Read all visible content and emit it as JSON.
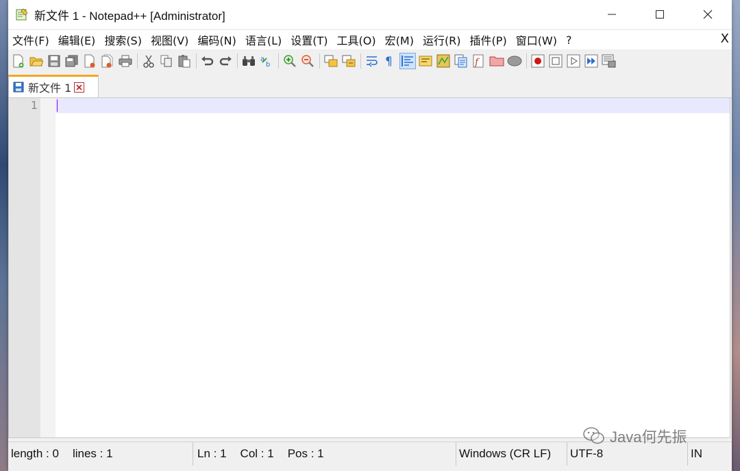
{
  "window": {
    "title": "新文件 1 - Notepad++ [Administrator]",
    "controls": {
      "minimize": "—",
      "maximize": "☐",
      "close": "✕"
    }
  },
  "menubar": {
    "items": [
      "文件(F)",
      "编辑(E)",
      "搜索(S)",
      "视图(V)",
      "编码(N)",
      "语言(L)",
      "设置(T)",
      "工具(O)",
      "宏(M)",
      "运行(R)",
      "插件(P)",
      "窗口(W)",
      "?"
    ],
    "close_label": "X"
  },
  "toolbar": {
    "icons": [
      "new-file",
      "open-file",
      "save",
      "save-all",
      "close",
      "close-all",
      "print",
      "cut",
      "copy",
      "paste",
      "undo",
      "redo",
      "find",
      "replace",
      "zoom-in",
      "zoom-out",
      "sync-vertical",
      "sync-horizontal",
      "word-wrap",
      "show-all-chars",
      "indent-guide",
      "user-defined-lang",
      "doc-map",
      "function-list",
      "folder-as-workspace",
      "monitoring",
      "record-macro",
      "stop-macro",
      "play-macro",
      "run-macro-multiple",
      "save-macro"
    ],
    "active_icon": "indent-guide"
  },
  "tabs": [
    {
      "label": "新文件 1",
      "active": true
    }
  ],
  "editor": {
    "line_numbers": [
      "1"
    ],
    "content": "",
    "current_line_color": "#e8e8ff",
    "caret_color": "#8000ff"
  },
  "statusbar": {
    "length": "length : 0",
    "lines": "lines : 1",
    "ln": "Ln : 1",
    "col": "Col : 1",
    "pos": "Pos : 1",
    "eol": "Windows (CR LF)",
    "encoding": "UTF-8",
    "mode": "IN"
  },
  "watermark": {
    "text": "Java何先振"
  },
  "colors": {
    "tab_accent": "#f5a623",
    "tab_close": "#b03030"
  }
}
